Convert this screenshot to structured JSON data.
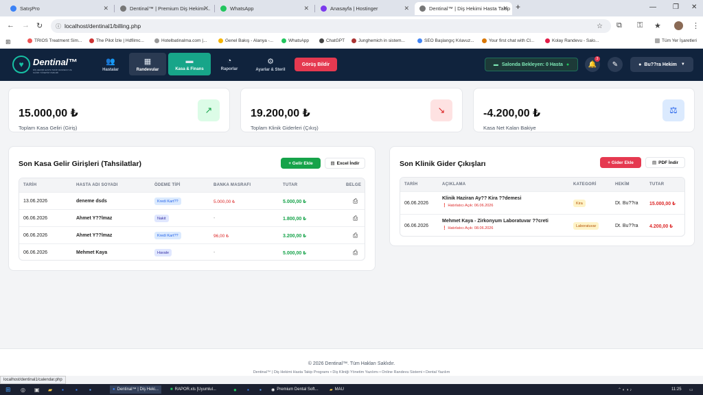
{
  "browser": {
    "tabs": [
      {
        "title": "SatışPro",
        "color": "#3b82f6"
      },
      {
        "title": "Dentinal™ | Premium Diş Hekimi ...",
        "color": "#555555"
      },
      {
        "title": "WhatsApp",
        "color": "#22c55e"
      },
      {
        "title": "Anasayfa | Hostinger",
        "color": "#7c3aed"
      },
      {
        "title": "Dentinal™ | Diş Hekimi Hasta Takip",
        "color": "#555555"
      }
    ],
    "new_tab": "+",
    "url": "localhost/dentinal1/billing.php",
    "bookmarks": [
      "TRIOS Treatment Sim...",
      "The Pilot İzle | Hdfilmc...",
      "Hotelbatinalma.com |...",
      "Genel Bakış - Alanya -...",
      "WhatsApp",
      "ChatGPT",
      "Junghemich in sistem...",
      "SEO Başlangıç Kılavuz...",
      "Your first chat with Cl...",
      "Kolay Randevu - Salo..."
    ],
    "all_bookmarks": "Tüm Yer İşaretleri"
  },
  "app": {
    "logo": "Dentinal™",
    "logo_sub": "DİŞ HEKİMİ HASTA TAKİP, RANDEVU VE KLİNİK YÖNETİM YAZILIMI",
    "nav": [
      {
        "label": "Hastalar",
        "icon": "users-icon"
      },
      {
        "label": "Randevular",
        "icon": "calendar-icon"
      },
      {
        "label": "Kasa & Finans",
        "icon": "wallet-icon"
      },
      {
        "label": "Raporlar",
        "icon": "chart-pie-icon"
      },
      {
        "label": "Ayarlar & Steril",
        "icon": "cogs-icon"
      }
    ],
    "feedback": "Görüş Bildir",
    "waiting": "Salonda Bekleyen: 0 Hasta",
    "notif_count": "3",
    "user": "Bu??ra Hekim"
  },
  "stats": [
    {
      "value": "15.000,00 ₺",
      "label": "Toplam Kasa Geliri (Giriş)",
      "icon": "↗",
      "color": "#16a34a",
      "bg": "#dcfce7"
    },
    {
      "value": "19.200,00 ₺",
      "label": "Toplam Klinik Giderleri (Çıkış)",
      "icon": "↘",
      "color": "#dc2626",
      "bg": "#fee2e2"
    },
    {
      "value": "-4.200,00 ₺",
      "label": "Kasa Net Kalan Bakiye",
      "icon": "⚖",
      "color": "#2563eb",
      "bg": "#dbeafe"
    }
  ],
  "income": {
    "title": "Son Kasa Gelir Girişleri (Tahsilatlar)",
    "add_btn": "+ Gelir Ekle",
    "excel_btn": "Excel İndir",
    "headers": [
      "TARİH",
      "HASTA ADI SOYADI",
      "ÖDEME TİPİ",
      "BANKA MASRAFI",
      "TUTAR",
      "BELGE"
    ],
    "rows": [
      {
        "date": "13.06.2026",
        "name": "deneme dsds",
        "type": "Kredi Kart??",
        "fee": "5.000,00 ₺",
        "amount": "5.000,00 ₺"
      },
      {
        "date": "06.06.2026",
        "name": "Ahmet Y??lmaz",
        "type": "Nakit",
        "fee": "-",
        "amount": "1.800,00 ₺"
      },
      {
        "date": "06.06.2026",
        "name": "Ahmet Y??lmaz",
        "type": "Kredi Kart??",
        "fee": "96,00 ₺",
        "amount": "3.200,00 ₺"
      },
      {
        "date": "06.06.2026",
        "name": "Mehmet Kaya",
        "type": "Havale",
        "fee": "-",
        "amount": "5.000,00 ₺"
      }
    ]
  },
  "expense": {
    "title": "Son Klinik Gider Çıkışları",
    "add_btn": "+ Gider Ekle",
    "pdf_btn": "PDF İndir",
    "headers": [
      "TARİH",
      "AÇIKLAMA",
      "KATEGORİ",
      "HEKİM",
      "TUTAR"
    ],
    "rows": [
      {
        "date": "06.06.2026",
        "desc": "Klinik Haziran Ay?? Kira ??demesi",
        "note": "Hatırlatıcı Açık: 06.06.2026",
        "cat": "Kira",
        "doctor": "Dt. Bu??ra",
        "amount": "15.000,00 ₺"
      },
      {
        "date": "06.06.2026",
        "desc": "Mehmet Kaya - Zirkonyum Laboratuvar ??creti",
        "note": "Hatırlatıcı Açık: 08.06.2026",
        "cat": "Laboratuvar",
        "doctor": "Dt. Bu??ra",
        "amount": "4.200,00 ₺"
      }
    ]
  },
  "footer": {
    "copy": "© 2026 Dentinal™. Tüm Hakları Saklıdır.",
    "sub": "Dentinal™ | Diş Hekimi Hasta Takip Programı • Diş Kliniği Yönetim Yazılımı • Online Randevu Sistemi • Dental Yazılım"
  },
  "status_url": "localhost/dentinal1/calendar.php",
  "taskbar": {
    "items": [
      "Dentinal™ | Diş Heki...",
      "RAPOR.xls [Uyumlul...",
      "Premium Dental Soft...",
      "MAU"
    ],
    "time": "11:25"
  }
}
